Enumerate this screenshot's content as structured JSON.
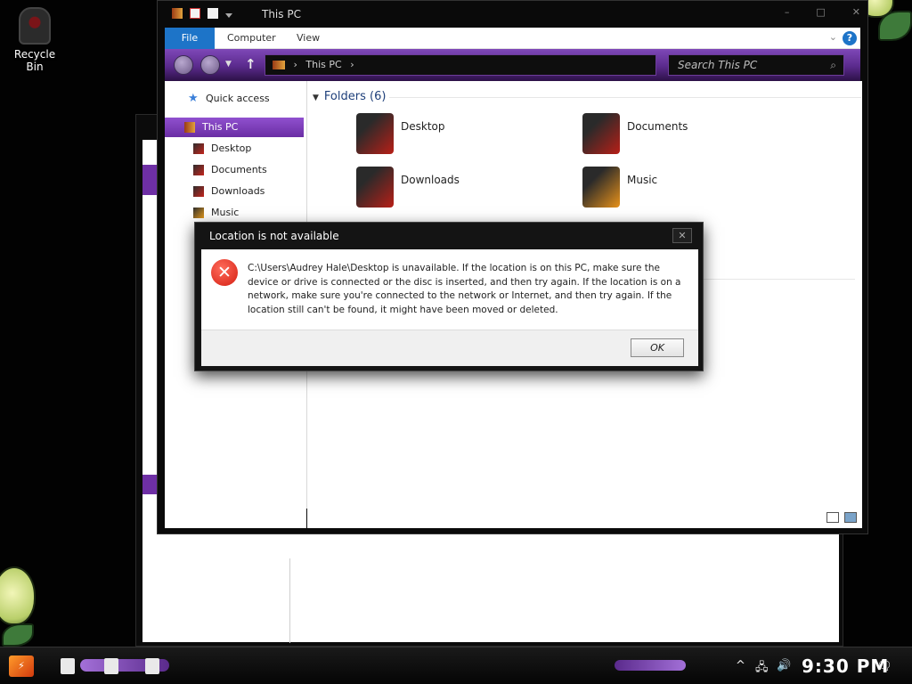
{
  "desktop": {
    "recycle_bin_label": "Recycle Bin"
  },
  "explorer": {
    "title": "This PC",
    "ribbon_tabs": [
      "File",
      "Computer",
      "View"
    ],
    "help_glyph": "?",
    "address": "This PC",
    "search_placeholder": "Search This PC",
    "sidebar": {
      "items": [
        {
          "label": "Quick access",
          "icon": "star-icon"
        },
        {
          "label": "This PC",
          "icon": "pc-icon",
          "selected": true
        },
        {
          "label": "Desktop",
          "icon": "desktop-folder-icon"
        },
        {
          "label": "Documents",
          "icon": "documents-folder-icon"
        },
        {
          "label": "Downloads",
          "icon": "downloads-folder-icon"
        },
        {
          "label": "Music",
          "icon": "music-folder-icon"
        }
      ]
    },
    "folders_header": "Folders (6)",
    "folders": [
      {
        "label": "Desktop",
        "icon": "desktop-folder-icon"
      },
      {
        "label": "Documents",
        "icon": "documents-folder-icon"
      },
      {
        "label": "Downloads",
        "icon": "downloads-folder-icon"
      },
      {
        "label": "Music",
        "icon": "music-folder-icon"
      }
    ]
  },
  "dialog": {
    "title": "Location is not available",
    "close_glyph": "✕",
    "message": "C:\\Users\\Audrey Hale\\Desktop is unavailable. If the location is on this PC, make sure the device or drive is connected or the disc is inserted, and then try again. If the location is on a network, make sure you're connected to the network or Internet, and then try again. If the location still can't be found, it might have been moved or deleted.",
    "ok_label": "OK",
    "error_icon": "error-x-icon"
  },
  "taskbar": {
    "clock": "9:30 PM"
  },
  "colors": {
    "accent_purple": "#6e2fa5",
    "file_tab_blue": "#1d74c8",
    "error_red": "#d41f12"
  }
}
